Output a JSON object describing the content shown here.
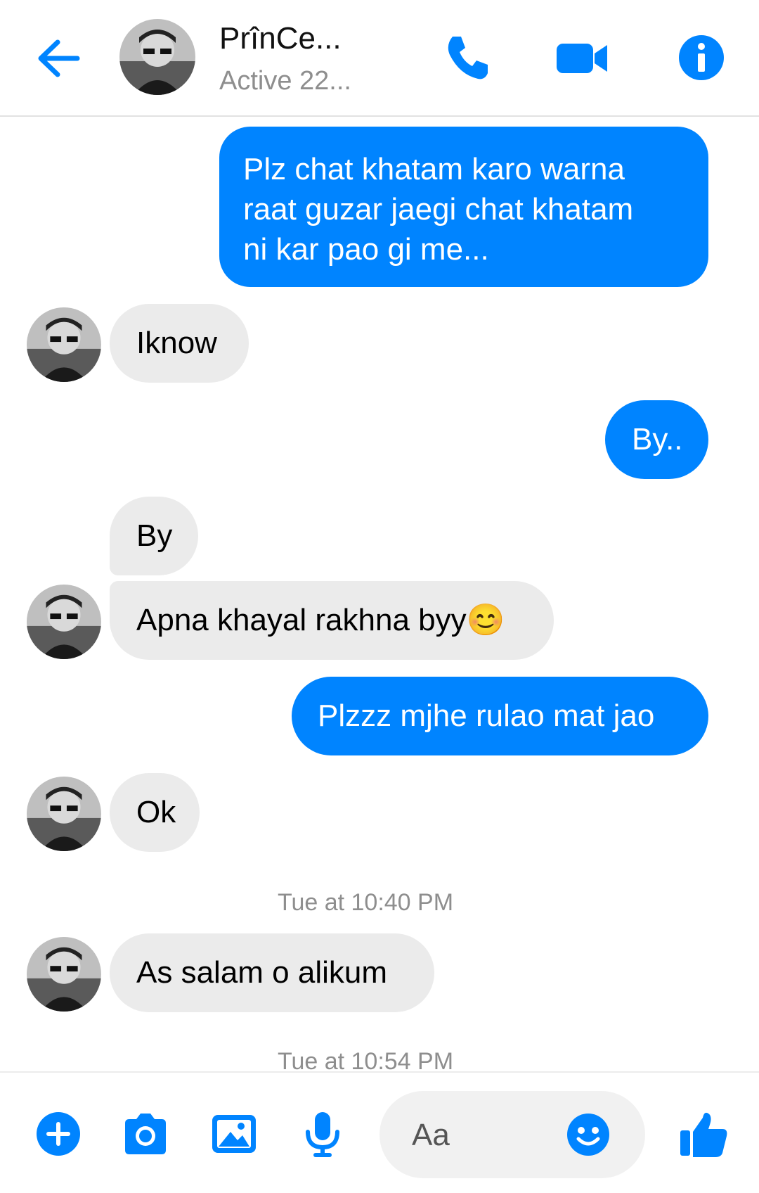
{
  "header": {
    "contact_name": "PrînCe...",
    "status": "Active 22..."
  },
  "messages": [
    {
      "side": "out",
      "text_lines": [
        "Plz chat khatam karo warna",
        "raat guzar jaegi chat khatam",
        "ni kar pao gi me..."
      ]
    },
    {
      "side": "in",
      "text": "Iknow"
    },
    {
      "side": "out",
      "text": "By.."
    },
    {
      "side": "in",
      "text": "By"
    },
    {
      "side": "in",
      "text": "Apna khayal rakhna byy",
      "emoji": "😊"
    },
    {
      "side": "out",
      "text": "Plzzz mjhe rulao mat jao"
    },
    {
      "side": "in",
      "text": "Ok"
    },
    {
      "side": "in",
      "text": "As salam o alikum"
    }
  ],
  "timestamps": [
    "Tue at 10:40 PM",
    "Tue at 10:54 PM"
  ],
  "composer": {
    "placeholder": "Aa"
  },
  "colors": {
    "accent": "#0084ff",
    "incoming_bubble": "#ebebeb",
    "muted_text": "#8e8e8e"
  },
  "icons": [
    "back-arrow-icon",
    "phone-icon",
    "video-camera-icon",
    "info-icon",
    "plus-icon",
    "camera-icon",
    "image-icon",
    "microphone-icon",
    "smiley-icon",
    "thumbs-up-icon"
  ]
}
